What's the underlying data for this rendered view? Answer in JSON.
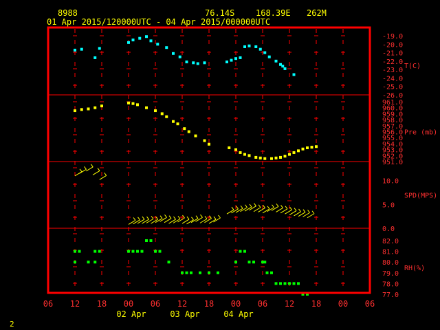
{
  "header": {
    "station_id": "8988",
    "latitude": "76.14S",
    "longitude": "168.39E",
    "elevation": "262M",
    "period": "01 Apr 2015/120000UTC - 04 Apr 2015/000000UTC"
  },
  "page_number": "2",
  "colors": {
    "frame": "#ff0000",
    "temperature": "#00ffff",
    "pressure": "#ffff00",
    "wind": "#ffff00",
    "rh": "#00ff00"
  },
  "x_axis": {
    "hour_labels": [
      "06",
      "12",
      "18",
      "00",
      "06",
      "12",
      "18",
      "00",
      "06",
      "12",
      "18",
      "00",
      "06"
    ],
    "date_labels": [
      {
        "text": "02 Apr",
        "hour_index": 2
      },
      {
        "text": "03 Apr",
        "hour_index": 4
      },
      {
        "text": "04 Apr",
        "hour_index": 6
      }
    ]
  },
  "chart_data": {
    "type": "scatter",
    "x_unit": "hours since 01 Apr 2015 06:00 UTC",
    "xlim": [
      0,
      72
    ],
    "panels": [
      {
        "name": "T(C)",
        "ylim": [
          -26,
          -19
        ],
        "tick_labels": [
          "-19.0",
          "-20.0",
          "-21.0",
          "-22.0",
          "-23.0",
          "-24.0",
          "-25.0",
          "-26.0"
        ],
        "series": [
          {
            "x": [
              6,
              7.5,
              10.5,
              11.5,
              18,
              19,
              20.5,
              22,
              23,
              24.5,
              26.5,
              28,
              29.5,
              31,
              32.5,
              33.5,
              35,
              40,
              41,
              42,
              43,
              44,
              45,
              46.5,
              47.5,
              48.5,
              49.5,
              51,
              52,
              52.5,
              53,
              55
            ],
            "y": [
              -20.7,
              -20.6,
              -21.6,
              -20.5,
              -19.8,
              -19.5,
              -19.3,
              -19.1,
              -19.6,
              -20.0,
              -20.4,
              -21.1,
              -21.5,
              -22.1,
              -22.2,
              -22.3,
              -22.2,
              -22.1,
              -21.9,
              -21.7,
              -21.6,
              -20.3,
              -20.2,
              -20.3,
              -20.6,
              -21.0,
              -21.5,
              -22.0,
              -22.4,
              -22.6,
              -22.9,
              -23.6
            ]
          }
        ]
      },
      {
        "name": "Pre (mb)",
        "ylim": [
          951,
          961
        ],
        "tick_labels": [
          "961.0",
          "960.0",
          "959.0",
          "958.0",
          "957.0",
          "956.0",
          "955.0",
          "954.0",
          "953.0",
          "952.0",
          "951.0"
        ],
        "series": [
          {
            "x": [
              6,
              7.5,
              9,
              10.5,
              12,
              18,
              19,
              20,
              22,
              24,
              25.5,
              26.5,
              28,
              29,
              30.5,
              31.5,
              33,
              35,
              36,
              40.5,
              42,
              43,
              44,
              45,
              46.5,
              47.5,
              48.5,
              50,
              51,
              52,
              53,
              54,
              55,
              56,
              57,
              58,
              59,
              60
            ],
            "y": [
              959.5,
              959.7,
              959.8,
              960.0,
              960.3,
              960.8,
              960.7,
              960.5,
              960.0,
              959.5,
              959.0,
              958.5,
              957.7,
              957.3,
              956.5,
              956.0,
              955.3,
              954.5,
              953.9,
              953.3,
              953.0,
              952.5,
              952.2,
              952.0,
              951.7,
              951.6,
              951.5,
              951.5,
              951.6,
              951.7,
              951.9,
              952.2,
              952.5,
              952.8,
              953.1,
              953.3,
              953.4,
              953.5
            ]
          }
        ]
      },
      {
        "name": "SPD(MPS)",
        "ylim": [
          0,
          14
        ],
        "tick_labels": [
          "0.0",
          "5.0",
          "10.0"
        ],
        "series": [
          {
            "x": [
              6,
              7,
              8.5,
              10,
              11.5,
              18,
              19,
              20,
              21,
              22,
              23,
              24,
              25,
              26,
              27,
              28,
              29,
              30,
              31,
              32,
              33,
              34,
              35,
              36,
              37,
              40,
              41,
              42,
              43,
              44,
              45,
              46,
              47,
              48,
              49,
              50,
              51,
              52,
              53,
              54,
              55,
              56,
              57,
              58
            ],
            "y": [
              11,
              11.5,
              12,
              11.2,
              10.2,
              0.8,
              0.9,
              1.0,
              1.0,
              1.1,
              1.0,
              1.2,
              1.4,
              1.2,
              1.0,
              1.1,
              1.3,
              1.0,
              0.9,
              1.2,
              1.4,
              1.1,
              1.2,
              1.0,
              1.3,
              3.0,
              3.2,
              3.3,
              3.5,
              3.6,
              3.8,
              3.5,
              3.4,
              3.2,
              3.5,
              3.7,
              3.4,
              3.2,
              3.0,
              2.8,
              2.6,
              2.5,
              2.4,
              2.2
            ]
          }
        ]
      },
      {
        "name": "RH(%)",
        "ylim": [
          77,
          82
        ],
        "tick_labels": [
          "82.0",
          "81.0",
          "80.0",
          "79.0",
          "78.0",
          "77.0"
        ],
        "series": [
          {
            "x": [
              6,
              6,
              7,
              9,
              10.5,
              10.5,
              11.5,
              18,
              19,
              20,
              21,
              22,
              23,
              24,
              25,
              27,
              30,
              31,
              32,
              34,
              36,
              38,
              42,
              43,
              44,
              45,
              46,
              48,
              48.5,
              49,
              50,
              51,
              52,
              53,
              54,
              55,
              56,
              57,
              58
            ],
            "y": [
              81,
              80,
              81,
              80,
              81,
              80,
              81,
              81,
              81,
              81,
              81,
              82,
              82,
              81,
              81,
              80,
              79,
              79,
              79,
              79,
              79,
              79,
              80,
              81,
              81,
              80,
              80,
              80,
              80,
              79,
              79,
              78,
              78,
              78,
              78,
              78,
              78,
              77,
              77
            ]
          }
        ]
      }
    ]
  }
}
